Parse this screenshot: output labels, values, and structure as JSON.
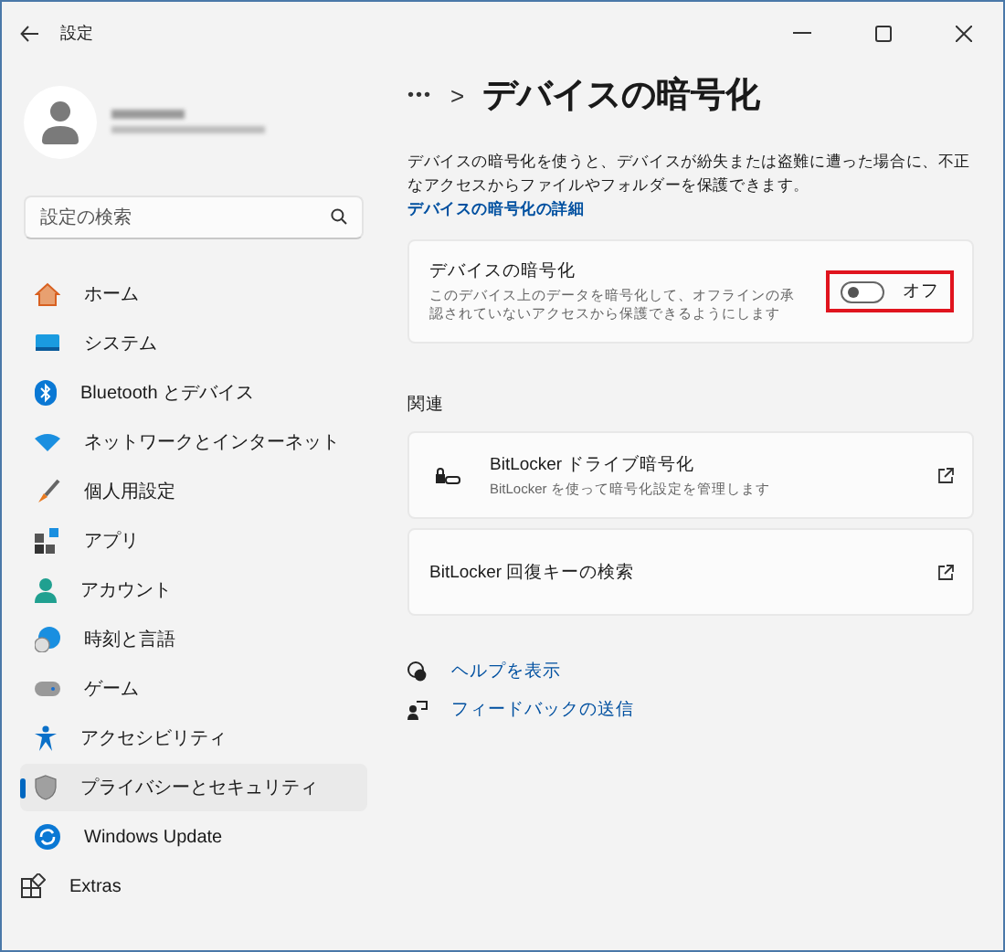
{
  "window": {
    "title": "設定"
  },
  "search": {
    "placeholder": "設定の検索"
  },
  "sidebar": {
    "items": [
      {
        "label": "ホーム",
        "selected": false,
        "kind": "nav"
      },
      {
        "label": "システム",
        "selected": false,
        "kind": "nav"
      },
      {
        "label": "Bluetooth とデバイス",
        "selected": false,
        "kind": "nav"
      },
      {
        "label": "ネットワークとインターネット",
        "selected": false,
        "kind": "nav"
      },
      {
        "label": "個人用設定",
        "selected": false,
        "kind": "nav"
      },
      {
        "label": "アプリ",
        "selected": false,
        "kind": "nav"
      },
      {
        "label": "アカウント",
        "selected": false,
        "kind": "nav"
      },
      {
        "label": "時刻と言語",
        "selected": false,
        "kind": "nav"
      },
      {
        "label": "ゲーム",
        "selected": false,
        "kind": "nav"
      },
      {
        "label": "アクセシビリティ",
        "selected": false,
        "kind": "nav"
      },
      {
        "label": "プライバシーとセキュリティ",
        "selected": true,
        "kind": "nav"
      },
      {
        "label": "Windows Update",
        "selected": false,
        "kind": "nav"
      },
      {
        "label": "Extras",
        "selected": false,
        "kind": "extras"
      }
    ]
  },
  "breadcrumb": {
    "more": "•••",
    "separator": ">",
    "title": "デバイスの暗号化"
  },
  "description": {
    "text": "デバイスの暗号化を使うと、デバイスが紛失または盗難に遭った場合に、不正なアクセスからファイルやフォルダーを保護できます。",
    "link": "デバイスの暗号化の詳細"
  },
  "encryption_card": {
    "title": "デバイスの暗号化",
    "subtitle": "このデバイス上のデータを暗号化して、オフラインの承認されていないアクセスから保護できるようにします",
    "toggle": {
      "on": false,
      "label": "オフ",
      "highlighted": true
    }
  },
  "related": {
    "heading": "関連",
    "items": [
      {
        "title": "BitLocker ドライブ暗号化",
        "subtitle": "BitLocker を使って暗号化設定を管理します",
        "kind": "icon"
      },
      {
        "title": "BitLocker 回復キーの検索",
        "kind": "plain"
      }
    ]
  },
  "help_links": [
    "ヘルプを表示",
    "フィードバックの送信"
  ]
}
